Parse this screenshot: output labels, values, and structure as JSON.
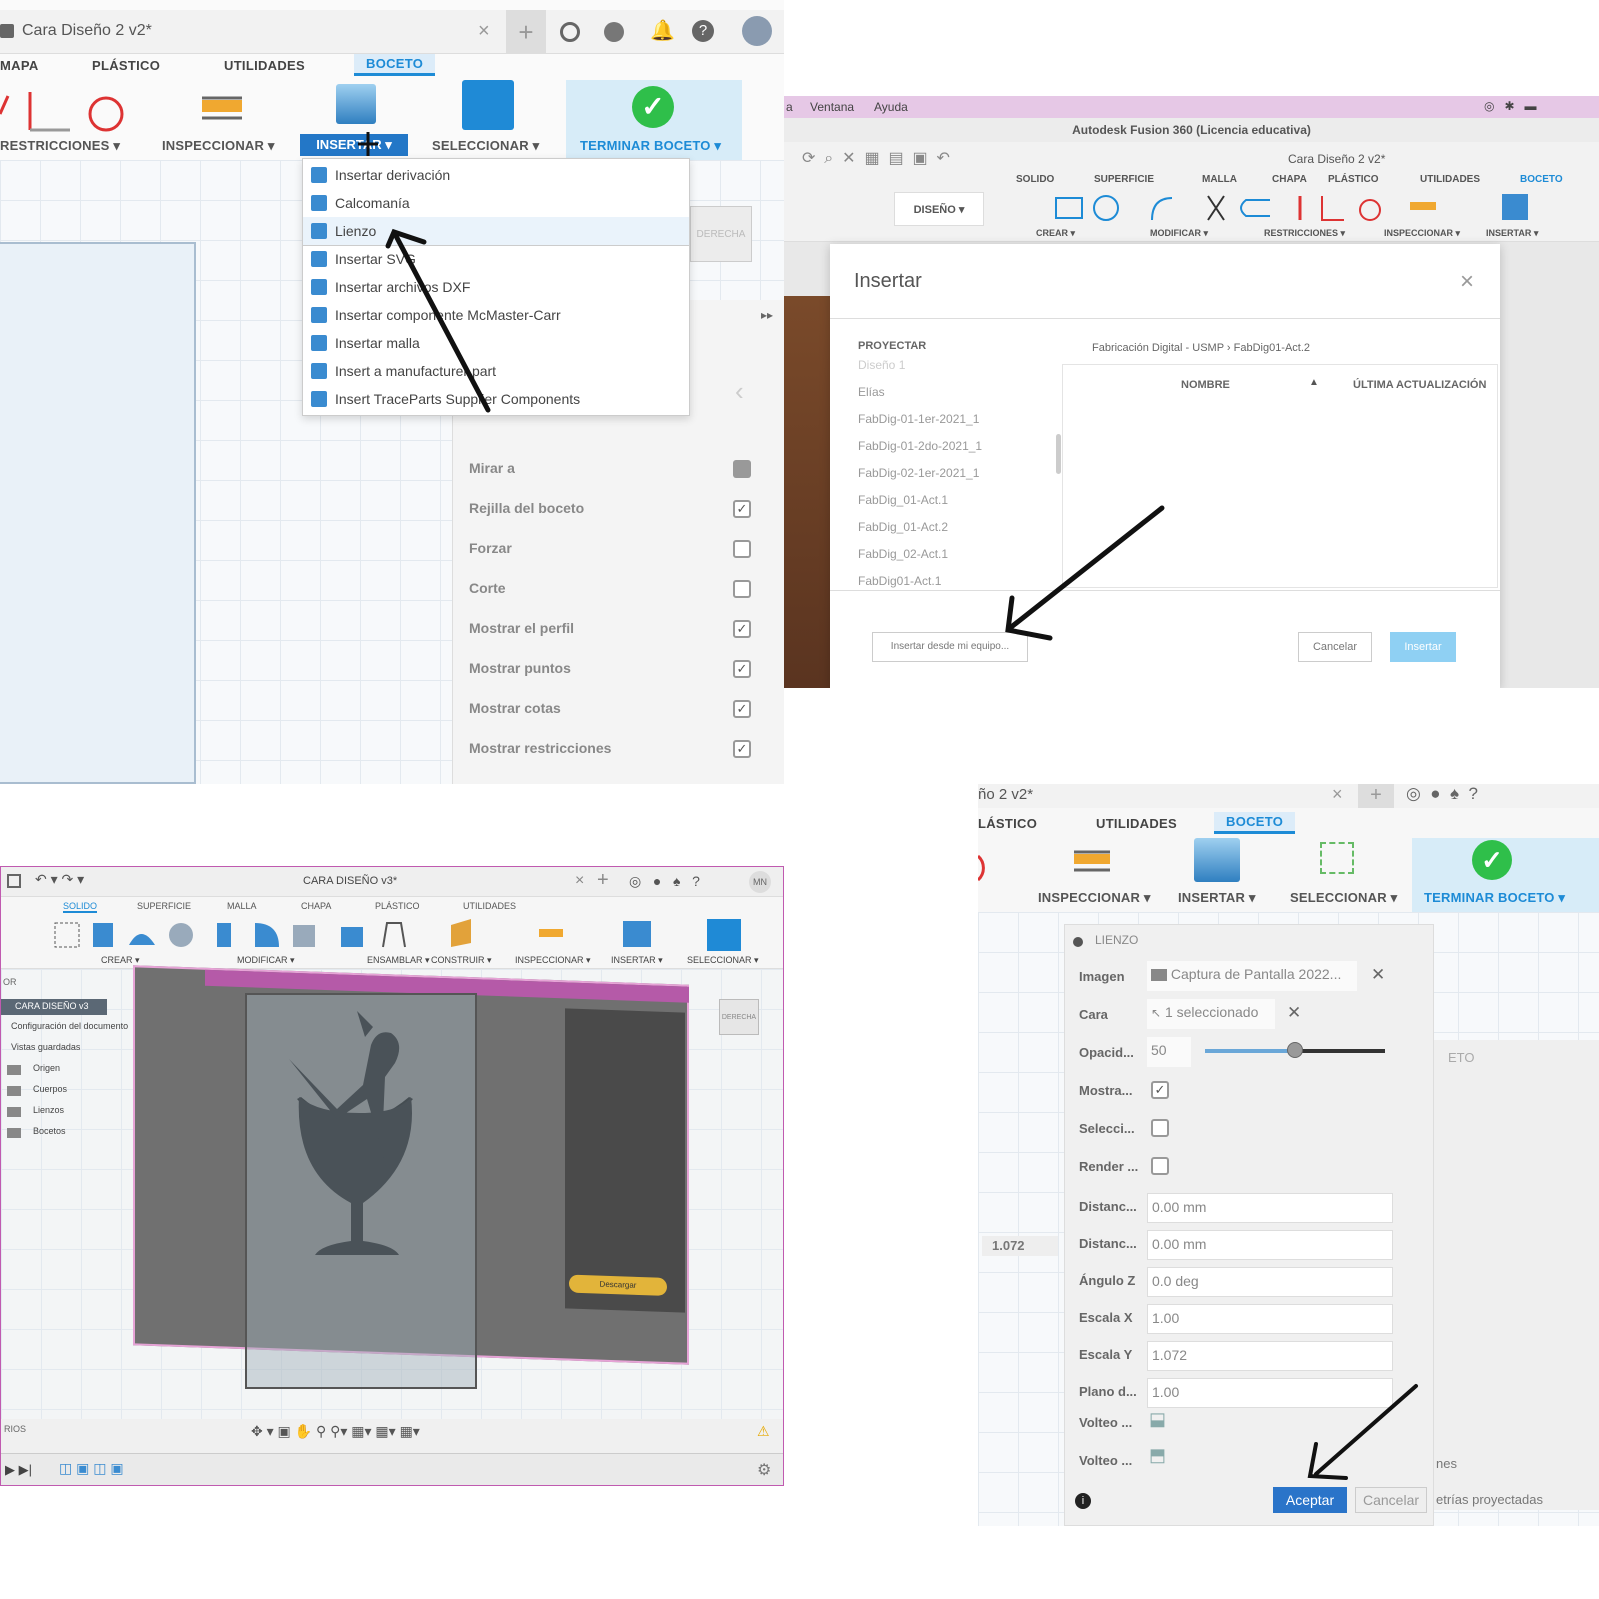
{
  "p1": {
    "window_title": "Cara Diseño 2 v2*",
    "tabs": [
      "MAPA",
      "PLÁSTICO",
      "UTILIDADES",
      "BOCETO"
    ],
    "toolbar": {
      "restrictions": "RESTRICCIONES ▾",
      "inspect": "INSPECCIONAR ▾",
      "insert": "INSERTAR ▾",
      "select": "SELECCIONAR ▾",
      "finish": "TERMINAR BOCETO ▾"
    },
    "menu": [
      "Insertar derivación",
      "Calcomanía",
      "Lienzo",
      "Insertar SVG",
      "Insertar archivos DXF",
      "Insertar componente McMaster-Carr",
      "Insertar malla",
      "Insert a manufacturer part",
      "Insert TraceParts Supplier Components"
    ],
    "palette": [
      {
        "label": "Mirar a",
        "checked": null
      },
      {
        "label": "Rejilla del boceto",
        "checked": true
      },
      {
        "label": "Forzar",
        "checked": false
      },
      {
        "label": "Corte",
        "checked": false
      },
      {
        "label": "Mostrar el perfil",
        "checked": true
      },
      {
        "label": "Mostrar puntos",
        "checked": true
      },
      {
        "label": "Mostrar cotas",
        "checked": true
      },
      {
        "label": "Mostrar restricciones",
        "checked": true
      }
    ],
    "view_cube": "DERECHA"
  },
  "p2": {
    "menubar": [
      "a",
      "Ventana",
      "Ayuda"
    ],
    "app_title": "Autodesk Fusion 360 (Licencia educativa)",
    "doc_title": "Cara Diseño 2 v2*",
    "tabs": [
      "SOLIDO",
      "SUPERFICIE",
      "MALLA",
      "CHAPA",
      "PLÁSTICO",
      "UTILIDADES",
      "BOCETO"
    ],
    "toolbar": [
      "DISEÑO ▾",
      "CREAR ▾",
      "MODIFICAR ▾",
      "RESTRICCIONES ▾",
      "INSPECCIONAR ▾",
      "INSERTAR ▾"
    ],
    "dialog": {
      "title": "Insertar",
      "section": "PROYECTAR",
      "breadcrumb": "Fabricación Digital - USMP  ›  FabDig01-Act.2",
      "columns": {
        "name": "NOMBRE",
        "updated": "ÚLTIMA ACTUALIZACIÓN"
      },
      "projects": [
        "Diseño 1",
        "Elías",
        "FabDig-01-1er-2021_1",
        "FabDig-01-2do-2021_1",
        "FabDig-02-1er-2021_1",
        "FabDig_01-Act.1",
        "FabDig_01-Act.2",
        "FabDig_02-Act.1",
        "FabDig01-Act.1"
      ],
      "local_button": "Insertar desde mi equipo...",
      "cancel": "Cancelar",
      "insert": "Insertar"
    }
  },
  "p3": {
    "doc_title": "CARA DISEÑO v3*",
    "user": "MN",
    "tabs": [
      "SOLIDO",
      "SUPERFICIE",
      "MALLA",
      "CHAPA",
      "PLÁSTICO",
      "UTILIDADES"
    ],
    "groups": [
      "CREAR ▾",
      "MODIFICAR ▾",
      "ENSAMBLAR ▾",
      "CONSTRUIR ▾",
      "INSPECCIONAR ▾",
      "INSERTAR ▾",
      "SELECCIONAR ▾"
    ],
    "browser": {
      "header": "OR",
      "root": "CARA DISEÑO v3",
      "items": [
        "Configuración del documento",
        "Vistas guardadas",
        "Origen",
        "Cuerpos",
        "Lienzos",
        "Bocetos"
      ],
      "footer": "RIOS"
    },
    "view_cube": "DERECHA",
    "download": "Descargar"
  },
  "p4": {
    "doc_title": "ño 2 v2*",
    "tabs": [
      "LÁSTICO",
      "UTILIDADES",
      "BOCETO"
    ],
    "toolbar": {
      "inspect": "INSPECCIONAR ▾",
      "insert": "INSERTAR ▾",
      "select": "SELECCIONAR ▾",
      "finish": "TERMINAR BOCETO ▾"
    },
    "dialog": {
      "title": "LIENZO",
      "image_label": "Imagen",
      "image_value": "Captura de Pantalla 2022...",
      "face_label": "Cara",
      "face_value": "1 seleccionado",
      "opacity_label": "Opacid...",
      "opacity_value": "50",
      "opacity": 0.5,
      "checks": [
        {
          "label": "Mostra...",
          "checked": true
        },
        {
          "label": "Selecci...",
          "checked": false
        },
        {
          "label": "Render ...",
          "checked": false
        }
      ],
      "fields": [
        {
          "label": "Distanc...",
          "value": "0.00 mm"
        },
        {
          "label": "Distanc...",
          "value": "0.00 mm"
        },
        {
          "label": "Ángulo Z",
          "value": "0.0 deg"
        },
        {
          "label": "Escala X",
          "value": "1.00"
        },
        {
          "label": "Escala Y",
          "value": "1.072"
        },
        {
          "label": "Plano d...",
          "value": "1.00"
        }
      ],
      "flip1": "Volteo ...",
      "flip2": "Volteo ...",
      "ok": "Aceptar",
      "cancel": "Cancelar"
    },
    "side_value": "1.072",
    "right_text1": "ETO",
    "right_text2": "nes",
    "right_text3": "etrías proyectadas"
  },
  "colors": {
    "accent": "#1d8bd6",
    "finish_green": "#2fbf4a",
    "chrome": "#f0f0f0",
    "pink_bar": "#e6c8e6"
  }
}
